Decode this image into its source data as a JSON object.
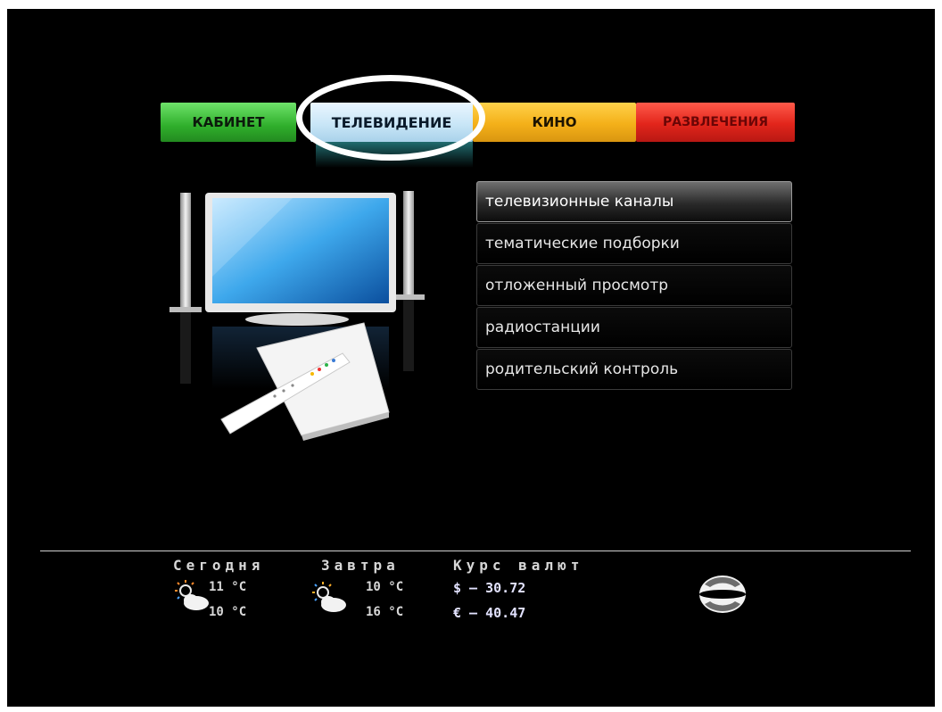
{
  "tabs": [
    {
      "label": "КАБИНЕТ"
    },
    {
      "label": "ТЕЛЕВИДЕНИЕ",
      "selected": true
    },
    {
      "label": "КИНО"
    },
    {
      "label": "РАЗВЛЕЧЕНИЯ"
    }
  ],
  "menu": {
    "items": [
      {
        "label": "телевизионные каналы",
        "active": true
      },
      {
        "label": "тематические подборки"
      },
      {
        "label": "отложенный просмотр"
      },
      {
        "label": "радиостанции"
      },
      {
        "label": "родительский контроль"
      }
    ]
  },
  "weather": {
    "today": {
      "label": "Сегодня",
      "day": "11 °C",
      "night": "10 °C",
      "icon": "sun-cloud-icon"
    },
    "tomorrow": {
      "label": "Завтра",
      "day": "10 °C",
      "night": "16 °C",
      "icon": "sun-cloud-icon"
    }
  },
  "rates": {
    "label": "Курс валют",
    "usd": "$ – 30.72",
    "eur": "€ – 40.47"
  },
  "colors": {
    "cabinet": "#2fae2b",
    "tv": "#c9e6f7",
    "kino": "#f4b019",
    "fun": "#e2251b"
  }
}
